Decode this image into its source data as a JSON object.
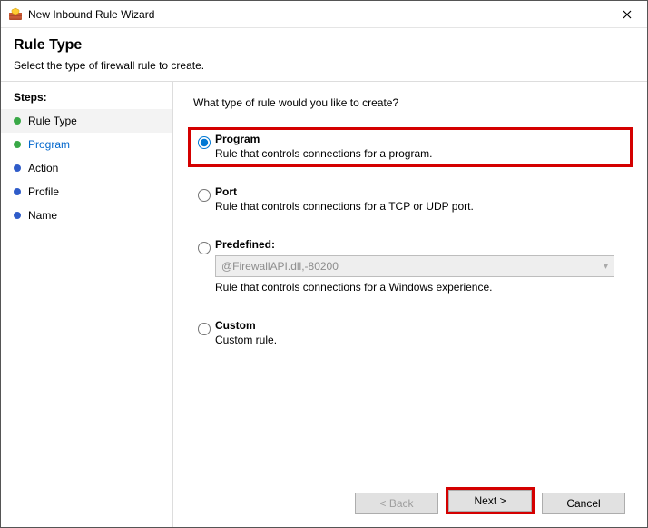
{
  "window": {
    "title": "New Inbound Rule Wizard"
  },
  "header": {
    "title": "Rule Type",
    "subtitle": "Select the type of firewall rule to create."
  },
  "sidebar": {
    "title": "Steps:",
    "steps": [
      {
        "label": "Rule Type",
        "bullet": "#39a847",
        "active": true,
        "current": false
      },
      {
        "label": "Program",
        "bullet": "#39a847",
        "active": false,
        "current": true
      },
      {
        "label": "Action",
        "bullet": "#2f5cc9",
        "active": false,
        "current": false
      },
      {
        "label": "Profile",
        "bullet": "#2f5cc9",
        "active": false,
        "current": false
      },
      {
        "label": "Name",
        "bullet": "#2f5cc9",
        "active": false,
        "current": false
      }
    ]
  },
  "main": {
    "question": "What type of rule would you like to create?",
    "options": {
      "program": {
        "label": "Program",
        "desc": "Rule that controls connections for a program."
      },
      "port": {
        "label": "Port",
        "desc": "Rule that controls connections for a TCP or UDP port."
      },
      "predefined": {
        "label": "Predefined:",
        "select_value": "@FirewallAPI.dll,-80200",
        "desc": "Rule that controls connections for a Windows experience."
      },
      "custom": {
        "label": "Custom",
        "desc": "Custom rule."
      }
    }
  },
  "buttons": {
    "back": "< Back",
    "next": "Next >",
    "cancel": "Cancel"
  }
}
